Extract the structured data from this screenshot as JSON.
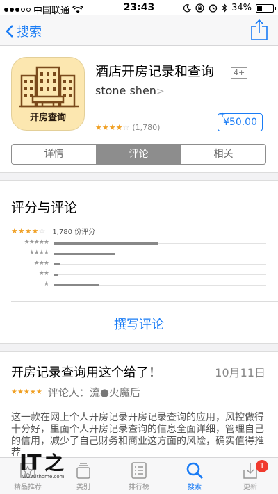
{
  "status_bar": {
    "carrier": "中国联通",
    "time": "23:43",
    "battery": "34%",
    "battery_level": 0.34
  },
  "nav": {
    "back_label": "搜索",
    "icons": [
      "back-chevron-icon",
      "share-icon"
    ]
  },
  "app": {
    "title": "酒店开房记录和查询",
    "age_rating": "4+",
    "developer": "stone shen",
    "rating_stars": 4,
    "rating_count": "(1,780)",
    "price": "¥50.00",
    "price_plus": "+",
    "icon_text": "开房查询",
    "icon_color": "#fce7b0"
  },
  "segment": {
    "tabs": [
      {
        "label": "详情",
        "active": false
      },
      {
        "label": "评论",
        "active": true
      },
      {
        "label": "相关",
        "active": false
      }
    ]
  },
  "ratings": {
    "section_title": "评分与评论",
    "average_stars": 4,
    "count_text": "1,780 份评分",
    "histogram": [
      {
        "stars": 5,
        "fraction": 0.49
      },
      {
        "stars": 4,
        "fraction": 0.29
      },
      {
        "stars": 3,
        "fraction": 0.03
      },
      {
        "stars": 2,
        "fraction": 0.02
      },
      {
        "stars": 1,
        "fraction": 0.21
      }
    ]
  },
  "write_review": "撰写评论",
  "review": {
    "title": "开房记录查询用这个给了！",
    "date": "10月11日",
    "stars": 5,
    "reviewer": "评论人：流●火魔后",
    "body": "这一款在网上个人开房记录开房记录查询的应用，风控做得十分好，里面个人开房记录查询的信息全面详细，管理自己的信用，减少了自己财务和商业这方面的风险，确实值得推荐"
  },
  "tabbar": {
    "tabs": [
      {
        "label": "精品推荐",
        "icon": "featured-icon",
        "active": false
      },
      {
        "label": "类别",
        "icon": "categories-icon",
        "active": false
      },
      {
        "label": "排行榜",
        "icon": "top-charts-icon",
        "active": false
      },
      {
        "label": "搜索",
        "icon": "search-icon",
        "active": true
      },
      {
        "label": "更新",
        "icon": "updates-icon",
        "active": false,
        "badge": "1"
      }
    ]
  },
  "watermark": {
    "logo": "IT之家",
    "url": "www.ithome.com"
  },
  "colors": {
    "accent": "#1a7cf5",
    "star": "#f0a024",
    "badge": "#f03a2e"
  }
}
